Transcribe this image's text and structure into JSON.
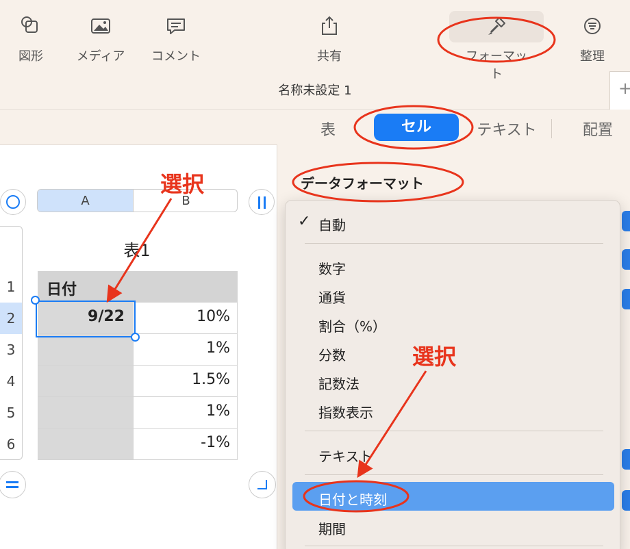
{
  "toolbar": {
    "shape_label": "図形",
    "media_label": "メディア",
    "comment_label": "コメント",
    "share_label": "共有",
    "format_label": "フォーマット",
    "organize_label": "整理"
  },
  "document": {
    "title": "名称未設定 1",
    "new_tab": "+"
  },
  "inspector": {
    "tabs": [
      "表",
      "セル",
      "テキスト",
      "配置"
    ],
    "active_tab": "セル",
    "section_title": "データフォーマット"
  },
  "format_menu": {
    "checkmark": "✓",
    "items": [
      "自動",
      "数字",
      "通貨",
      "割合（%）",
      "分数",
      "記数法",
      "指数表示",
      "テキスト",
      "日付と時刻",
      "期間"
    ],
    "selected": "自動",
    "highlighted": "日付と時刻"
  },
  "sheet": {
    "table_title": "表1",
    "columns": [
      "A",
      "B"
    ],
    "row_numbers": [
      "1",
      "2",
      "3",
      "4",
      "5",
      "6"
    ],
    "header_cell": "日付",
    "cells": [
      [
        "9/22",
        "10%"
      ],
      [
        "",
        "1%"
      ],
      [
        "",
        "1.5%"
      ],
      [
        "",
        "1%"
      ],
      [
        "",
        "-1%"
      ]
    ]
  },
  "annotations": {
    "label_1": "選択",
    "label_2": "選択"
  },
  "colors": {
    "accent": "#1a7cf5",
    "highlight": "#5b9ff0",
    "annotation": "#e8341c",
    "toolbar_bg": "#f8f1ea"
  }
}
